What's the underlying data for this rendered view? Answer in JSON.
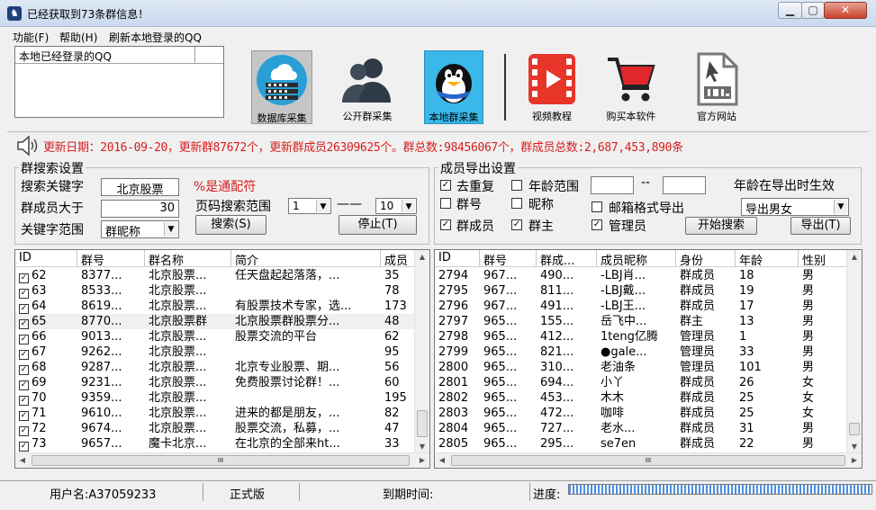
{
  "window": {
    "title": "已经获取到73条群信息！",
    "min_label": "▁",
    "max_label": "▢",
    "close_label": "✕"
  },
  "menu": [
    "功能(F)",
    "帮助(H)",
    "刷新本地登录的QQ"
  ],
  "qq_list": {
    "header": "本地已经登录的QQ"
  },
  "toolbar": [
    {
      "label": "数据库采集",
      "icon": "database-cloud-icon"
    },
    {
      "label": "公开群采集",
      "icon": "people-icon"
    },
    {
      "label": "本地群采集",
      "icon": "qq-penguin-icon"
    },
    {
      "label": "视频教程",
      "icon": "video-play-icon"
    },
    {
      "label": "购买本软件",
      "icon": "shopping-cart-icon"
    },
    {
      "label": "官方网站",
      "icon": "web-file-icon"
    }
  ],
  "notice": "更新日期：2016-09-20，更新群87672个，更新群成员26309625个。群总数:98456067个，群成员总数:2,687,453,890条",
  "group_search": {
    "title": "群搜索设置",
    "keyword_label": "搜索关键字",
    "keyword_value": "北京股票",
    "wildcard_hint": "%是通配符",
    "members_label": "群成员大于",
    "members_value": "30",
    "page_range_label": "页码搜索范围",
    "page_from": "1",
    "page_dash": "——",
    "page_to": "10",
    "scope_label": "关键字范围",
    "scope_value": "群昵称",
    "search_button": "搜索(S)",
    "stop_button": "停止(T)"
  },
  "member_export": {
    "title": "成员导出设置",
    "dedupe": {
      "label": "去重复",
      "checked": true
    },
    "age_range": {
      "label": "年龄范围",
      "checked": false,
      "from": "",
      "to": "",
      "dash": "--"
    },
    "age_hint": "年龄在导出时生效",
    "group_no": {
      "label": "群号",
      "checked": false
    },
    "nickname": {
      "label": "昵称",
      "checked": false
    },
    "email_fmt": {
      "label": "邮箱格式导出",
      "checked": false
    },
    "gender_select": "导出男女",
    "members": {
      "label": "群成员",
      "checked": true
    },
    "owner": {
      "label": "群主",
      "checked": true
    },
    "admin": {
      "label": "管理员",
      "checked": true
    },
    "start_button": "开始搜索",
    "export_button": "导出(T)"
  },
  "groups_table": {
    "columns": [
      "ID",
      "群号",
      "群名称",
      "简介",
      "成员"
    ],
    "rows": [
      [
        "62",
        "8377...",
        "北京股票...",
        "任天盘起起落落，...",
        "35"
      ],
      [
        "63",
        "8533...",
        "北京股票...",
        "",
        "78"
      ],
      [
        "64",
        "8619...",
        "北京股票...",
        "有股票技术专家，选...",
        "173"
      ],
      [
        "65",
        "8770...",
        "北京股票群",
        "北京股票群股票分...",
        "48"
      ],
      [
        "66",
        "9013...",
        "北京股票...",
        "股票交流的平台",
        "62"
      ],
      [
        "67",
        "9262...",
        "北京股票...",
        "",
        "95"
      ],
      [
        "68",
        "9287...",
        "北京股票...",
        "北京专业股票、期...",
        "56"
      ],
      [
        "69",
        "9231...",
        "北京股票...",
        "免费股票讨论群！...",
        "60"
      ],
      [
        "70",
        "9359...",
        "北京股票...",
        "",
        "195"
      ],
      [
        "71",
        "9610...",
        "北京股票...",
        "进来的都是朋友，...",
        "82"
      ],
      [
        "72",
        "9674...",
        "北京股票...",
        "股票交流，私募，...",
        "47"
      ],
      [
        "73",
        "9657...",
        "魔卡北京...",
        "在北京的全部来ht...",
        "33"
      ]
    ],
    "selected_row": 3,
    "scroll_up": "▲",
    "scroll_down": "▼",
    "scroll_left": "◀",
    "scroll_right": "▶",
    "grip": "III"
  },
  "members_table": {
    "columns": [
      "ID",
      "群号",
      "群成...",
      "成员昵称",
      "身份",
      "年龄",
      "性别"
    ],
    "rows": [
      [
        "2794",
        "967...",
        "490...",
        "-LBJ肖...",
        "群成员",
        "18",
        "男"
      ],
      [
        "2795",
        "967...",
        "811...",
        "-LBJ戴...",
        "群成员",
        "19",
        "男"
      ],
      [
        "2796",
        "967...",
        "491...",
        "-LBJ王...",
        "群成员",
        "17",
        "男"
      ],
      [
        "2797",
        "965...",
        "155...",
        "岳飞中...",
        "群主",
        "13",
        "男"
      ],
      [
        "2798",
        "965...",
        "412...",
        "1teng亿腾",
        "管理员",
        "1",
        "男"
      ],
      [
        "2799",
        "965...",
        "821...",
        "●gale...",
        "管理员",
        "33",
        "男"
      ],
      [
        "2800",
        "965...",
        "310...",
        "老油条",
        "管理员",
        "101",
        "男"
      ],
      [
        "2801",
        "965...",
        "694...",
        "小丫",
        "群成员",
        "26",
        "女"
      ],
      [
        "2802",
        "965...",
        "453...",
        "木木",
        "群成员",
        "25",
        "女"
      ],
      [
        "2803",
        "965...",
        "472...",
        "咖啡",
        "群成员",
        "25",
        "女"
      ],
      [
        "2804",
        "965...",
        "727...",
        "老水...",
        "群成员",
        "31",
        "男"
      ],
      [
        "2805",
        "965...",
        "295...",
        "se7en",
        "群成员",
        "22",
        "男"
      ]
    ]
  },
  "status": {
    "username": "用户名:A37059233",
    "edition": "正式版",
    "expiry": "到期时间:",
    "progress_label": "进度:"
  },
  "colors": {
    "notice": "#d81e1e",
    "local_tool_bg": "#39b8e9",
    "progress": "#4c8fe0"
  }
}
